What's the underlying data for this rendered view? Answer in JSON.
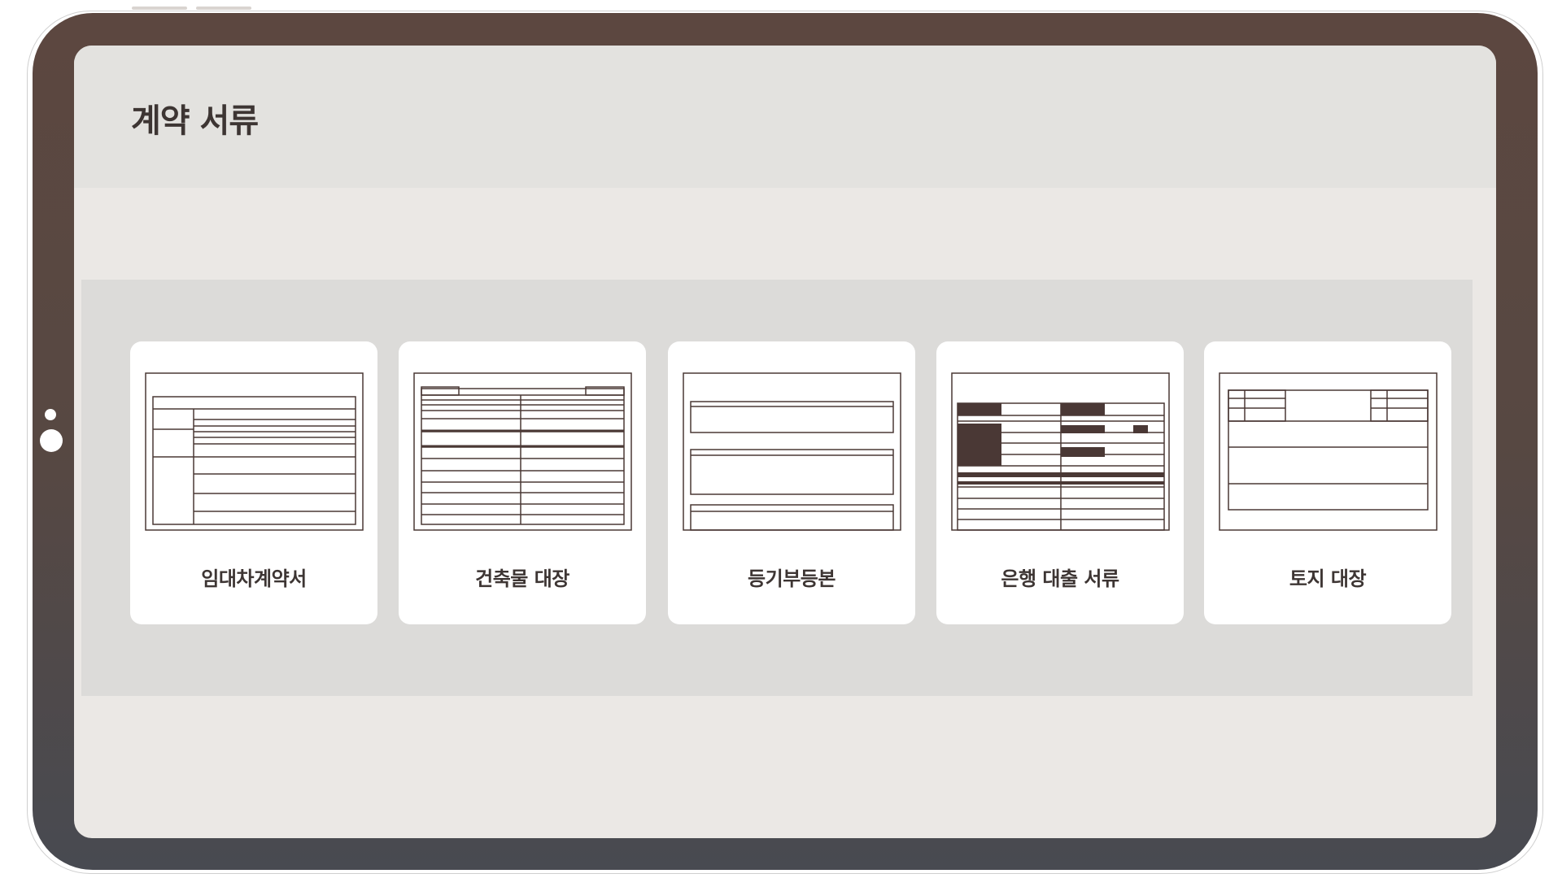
{
  "colors": {
    "frame_top": "#5c4740",
    "frame_bottom": "#484a51",
    "ink": "#4a3835",
    "screen_bg": "#ebe8e5",
    "panel_bg": "#dcdbd9",
    "card_bg": "#ffffff"
  },
  "header": {
    "title": "계약 서류"
  },
  "cards": [
    {
      "label": "임대차계약서",
      "icon": "lease-contract-icon"
    },
    {
      "label": "건축물 대장",
      "icon": "building-register-icon"
    },
    {
      "label": "등기부등본",
      "icon": "property-registry-icon"
    },
    {
      "label": "은행 대출 서류",
      "icon": "bank-loan-document-icon"
    },
    {
      "label": "토지 대장",
      "icon": "land-register-icon"
    }
  ]
}
